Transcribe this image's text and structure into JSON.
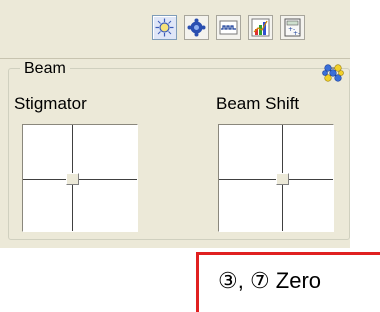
{
  "toolbar": {
    "buttons": [
      {
        "name": "beam-button",
        "icon": "sun-crosshair-icon",
        "active": true
      },
      {
        "name": "settings-button",
        "icon": "gear-icon",
        "active": false
      },
      {
        "name": "waveform-button",
        "icon": "waveform-icon",
        "active": false
      },
      {
        "name": "chart-button",
        "icon": "bar-chart-icon",
        "active": false
      },
      {
        "name": "calculator-button",
        "icon": "calculator-icon",
        "active": false
      }
    ]
  },
  "beam_group": {
    "legend": "Beam",
    "icon": "molecule-icon",
    "stigmator_label": "Stigmator",
    "beam_shift_label": "Beam Shift"
  },
  "callout": {
    "text": "③, ⑦ Zero",
    "border_color": "#e02020"
  }
}
